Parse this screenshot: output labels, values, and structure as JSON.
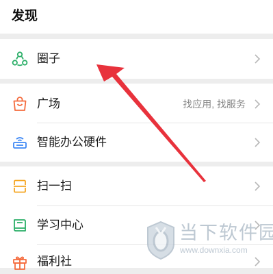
{
  "header": {
    "title": "发现"
  },
  "groups": [
    {
      "items": [
        {
          "label": "圈子",
          "icon": "circle-people-icon",
          "color": "#2aae67"
        }
      ]
    },
    {
      "items": [
        {
          "label": "广场",
          "icon": "shopping-bag-icon",
          "color": "#f56b3d",
          "extra": "找应用, 找服务"
        },
        {
          "label": "智能办公硬件",
          "icon": "hardware-device-icon",
          "color": "#3d87f5"
        }
      ]
    },
    {
      "items": [
        {
          "label": "扫一扫",
          "icon": "scan-icon",
          "color": "#f5a623"
        },
        {
          "label": "学习中心",
          "icon": "book-icon",
          "color": "#2aae67"
        },
        {
          "label": "福利社",
          "icon": "gift-icon",
          "color": "#f56b3d"
        }
      ]
    }
  ],
  "annotation": {
    "arrow_color": "#e8323c"
  },
  "watermark": {
    "title": "当下软件园",
    "url": "www.downxia.com"
  }
}
